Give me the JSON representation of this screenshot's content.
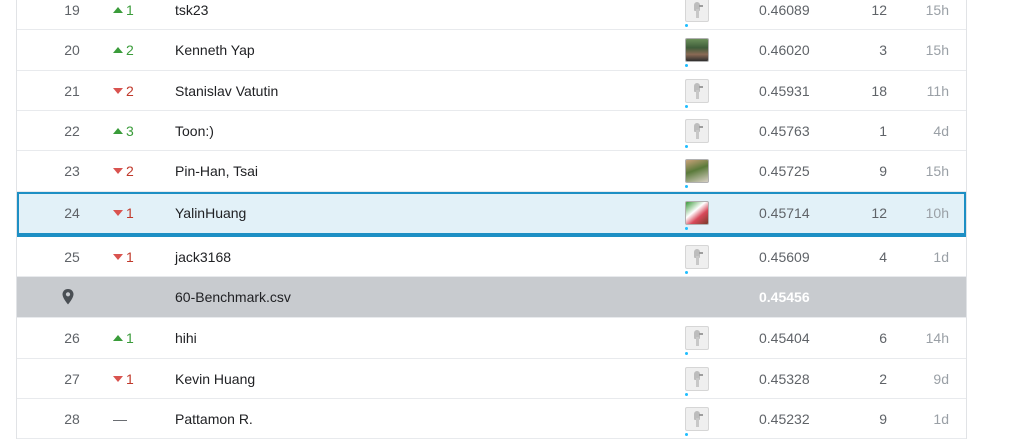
{
  "rows": [
    {
      "rank": "19",
      "change": "1",
      "dir": "up",
      "name": "tsk23",
      "score": "0.46089",
      "entries": "12",
      "last": "15h",
      "avatar": "goose"
    },
    {
      "rank": "20",
      "change": "2",
      "dir": "up",
      "name": "Kenneth Yap",
      "score": "0.46020",
      "entries": "3",
      "last": "15h",
      "avatar": "photo"
    },
    {
      "rank": "21",
      "change": "2",
      "dir": "down",
      "name": "Stanislav Vatutin",
      "score": "0.45931",
      "entries": "18",
      "last": "11h",
      "avatar": "goose"
    },
    {
      "rank": "22",
      "change": "3",
      "dir": "up",
      "name": "Toon:)",
      "score": "0.45763",
      "entries": "1",
      "last": "4d",
      "avatar": "goose"
    },
    {
      "rank": "23",
      "change": "2",
      "dir": "down",
      "name": "Pin-Han, Tsai",
      "score": "0.45725",
      "entries": "9",
      "last": "15h",
      "avatar": "photo2"
    },
    {
      "rank": "24",
      "change": "1",
      "dir": "down",
      "name": "YalinHuang",
      "score": "0.45714",
      "entries": "12",
      "last": "10h",
      "avatar": "photo3"
    },
    {
      "rank": "25",
      "change": "1",
      "dir": "down",
      "name": "jack3168",
      "score": "0.45609",
      "entries": "4",
      "last": "1d",
      "avatar": "goose"
    },
    {
      "name": "60-Benchmark.csv",
      "score": "0.45456",
      "benchmark": true
    },
    {
      "rank": "26",
      "change": "1",
      "dir": "up",
      "name": "hihi",
      "score": "0.45404",
      "entries": "6",
      "last": "14h",
      "avatar": "goose"
    },
    {
      "rank": "27",
      "change": "1",
      "dir": "down",
      "name": "Kevin Huang",
      "score": "0.45328",
      "entries": "2",
      "last": "9d",
      "avatar": "goose"
    },
    {
      "rank": "28",
      "change": "—",
      "dir": "flat",
      "name": "Pattamon R.",
      "score": "0.45232",
      "entries": "9",
      "last": "1d",
      "avatar": "goose"
    }
  ],
  "icons": {
    "benchmark": "map-pin-icon",
    "avatar_default": "goose-avatar-icon"
  },
  "colors": {
    "up": "#3a9c3a",
    "down": "#d9534f",
    "selected_border": "#1d8fc4",
    "benchmark_bg": "#c8cbcf"
  }
}
